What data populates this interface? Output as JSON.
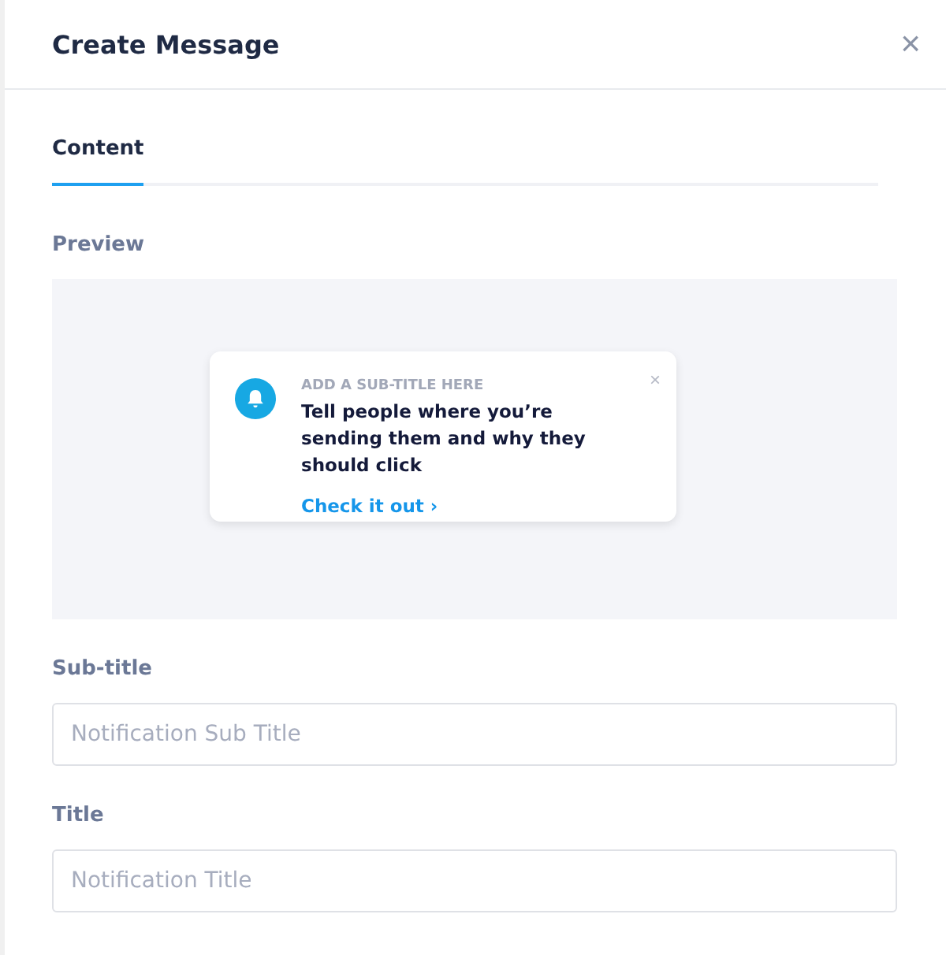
{
  "window": {
    "title": "Create Message",
    "close": "×"
  },
  "tabs": [
    {
      "label": "Content",
      "selected": true
    }
  ],
  "preview": {
    "label": "Preview",
    "notification": {
      "subtitle": "ADD A SUB-TITLE HERE",
      "title": "Tell people where you’re sending them and why they should click",
      "link": "Check it out ›",
      "close": "×"
    }
  },
  "fields": [
    {
      "label": "Sub-title",
      "placeholder": "Notification Sub Title"
    },
    {
      "label": "Title",
      "placeholder": "Notification Title"
    }
  ]
}
